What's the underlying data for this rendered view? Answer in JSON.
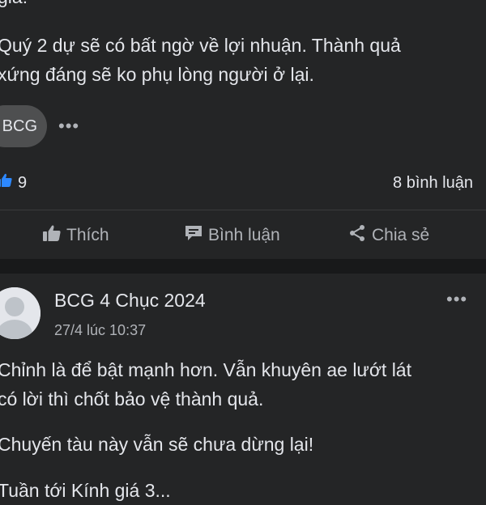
{
  "post1": {
    "partial_top_line": "giá!",
    "text": "Quý 2 dự sẽ có bất ngờ về lợi nhuận. Thành quả\nxứng đáng sẽ ko phụ lòng người ở lại.",
    "tag": "BCG",
    "like_count": "9",
    "comment_count": "8 bình luận"
  },
  "actions": {
    "like": "Thích",
    "comment": "Bình luận",
    "share": "Chia sẻ"
  },
  "post2": {
    "author": "BCG 4 Chục 2024",
    "timestamp": "27/4 lúc 10:37",
    "paragraph1": "Chỉnh là để bật mạnh hơn. Vẫn khuyên ae lướt lát\ncó lời thì chốt bảo vệ thành quả.",
    "paragraph2": "Chuyến tàu này vẫn sẽ chưa dừng lại!",
    "partial_bottom_line": "Tuần tới Kính giá 3..."
  },
  "colors": {
    "background": "#242526",
    "separator": "#18191a",
    "text": "#e4e6eb",
    "muted": "#b0b3b8",
    "like_blue": "#2d88ff"
  },
  "icons": [
    "thumbs-up-icon",
    "comment-icon",
    "share-icon",
    "more-icon",
    "avatar-placeholder-icon"
  ]
}
